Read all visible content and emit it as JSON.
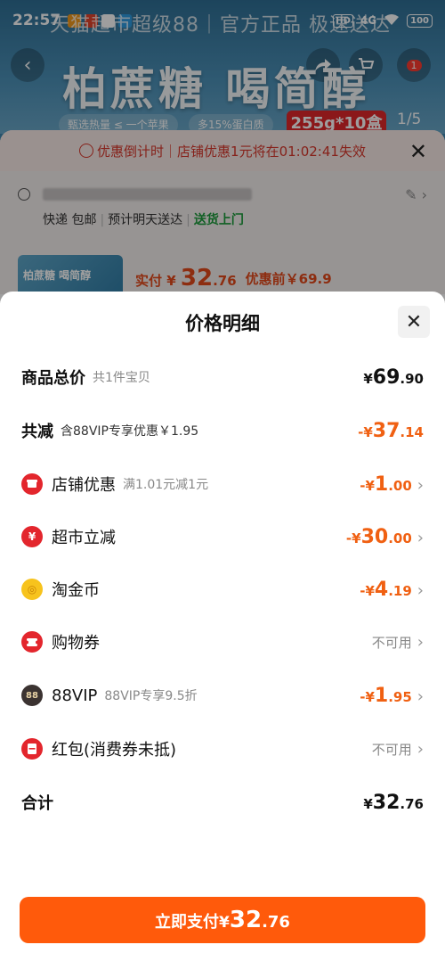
{
  "status_bar": {
    "time": "22:57",
    "network_hd": "HD",
    "network_4g": "4G",
    "battery": "100"
  },
  "background": {
    "banner_text": "天猫超市超级88｜官方正品 极速送达",
    "product_title": "柏蔗糖 喝简醇",
    "tags": [
      "甄选热量 ≤ 一个苹果",
      "多15%蛋白质"
    ],
    "red_tag": "255g*10盒",
    "pager": "1/5",
    "cart_badge": "1",
    "countdown": "优惠倒计时｜店铺优惠1元将在01:02:41失效",
    "shipping": {
      "express": "快递 包邮",
      "eta": "预计明天送达",
      "door": "送货上门"
    },
    "thumb_text": "柏蔗糖 喝简醇",
    "paid_label": "实付",
    "paid_amount": "32",
    "paid_decimal": ".76",
    "before_label": "优惠前￥69.9"
  },
  "sheet": {
    "title": "价格明细",
    "rows": [
      {
        "label": "商品总价",
        "sub": "共1件宝贝",
        "yen": "¥",
        "int": "69",
        "dec": ".90"
      },
      {
        "label": "共减",
        "sub": "含88VIP专享优惠￥1.95",
        "yen": "-¥",
        "int": "37",
        "dec": ".14"
      },
      {
        "label": "店铺优惠",
        "sub": "满1.01元减1元",
        "yen": "-¥",
        "int": "1",
        "dec": ".00"
      },
      {
        "label": "超市立减",
        "sub": "",
        "yen": "-¥",
        "int": "30",
        "dec": ".00"
      },
      {
        "label": "淘金币",
        "sub": "",
        "yen": "-¥",
        "int": "4",
        "dec": ".19"
      },
      {
        "label": "购物券",
        "sub": "",
        "status": "不可用"
      },
      {
        "label": "88VIP",
        "sub": "88VIP专享9.5折",
        "yen": "-¥",
        "int": "1",
        "dec": ".95"
      },
      {
        "label": "红包(消费券未抵)",
        "sub": "",
        "status": "不可用"
      },
      {
        "label": "合计",
        "sub": "",
        "yen": "¥",
        "int": "32",
        "dec": ".76"
      }
    ],
    "pay_button": {
      "label": "立即支付",
      "yen": "¥",
      "int": "32",
      "dec": ".76"
    }
  },
  "colors": {
    "accent": "#ff5a0b",
    "discount": "#f06012",
    "coupon_icon": "#e3262d",
    "coin_icon": "#f7c31d"
  }
}
